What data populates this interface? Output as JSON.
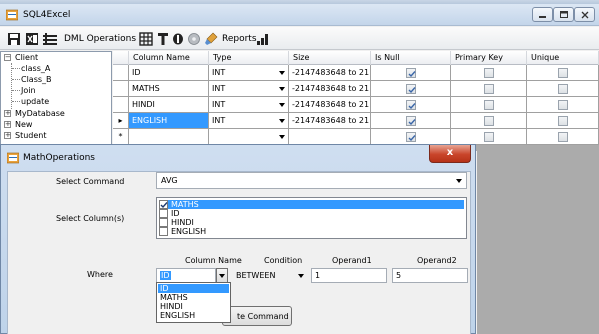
{
  "window": {
    "title": "SQL4Excel"
  },
  "toolbar": {
    "dml_label": "DML Operations",
    "reports_label": "Reports"
  },
  "tree": {
    "items": [
      {
        "label": "Client",
        "expander": "−"
      },
      {
        "label": "class_A"
      },
      {
        "label": "Class_B"
      },
      {
        "label": "Join"
      },
      {
        "label": "update"
      },
      {
        "label": "MyDatabase",
        "expander": "+"
      },
      {
        "label": "New",
        "expander": "+"
      },
      {
        "label": "Student",
        "expander": "+"
      }
    ]
  },
  "grid": {
    "columns": [
      "Column Name",
      "Type",
      "Size",
      "Is Null",
      "Primary Key",
      "Unique"
    ],
    "rows": [
      {
        "name": "ID",
        "type": "INT",
        "size": "-2147483648 to 21...",
        "is_null": true,
        "primary_key": false,
        "unique": false,
        "marker": ""
      },
      {
        "name": "MATHS",
        "type": "INT",
        "size": "-2147483648 to 21...",
        "is_null": true,
        "primary_key": false,
        "unique": false,
        "marker": ""
      },
      {
        "name": "HINDI",
        "type": "INT",
        "size": "-2147483648 to 21...",
        "is_null": true,
        "primary_key": false,
        "unique": false,
        "marker": ""
      },
      {
        "name": "ENGLISH",
        "type": "INT",
        "size": "-2147483648 to 21...",
        "is_null": true,
        "primary_key": false,
        "unique": false,
        "marker": "▸"
      },
      {
        "name": "",
        "type": "",
        "size": "",
        "is_null": true,
        "primary_key": false,
        "unique": false,
        "marker": "*"
      }
    ]
  },
  "dialog": {
    "title": "MathOperations",
    "close_label": "x",
    "select_command_label": "Select Command",
    "command_value": "AVG",
    "select_columns_label": "Select Column(s)",
    "columns": [
      {
        "label": "MATHS",
        "checked": true,
        "selected": true
      },
      {
        "label": "ID",
        "checked": false,
        "selected": false
      },
      {
        "label": "HINDI",
        "checked": false,
        "selected": false
      },
      {
        "label": "ENGLISH",
        "checked": false,
        "selected": false
      }
    ],
    "where_label": "Where",
    "where_headers": {
      "column_name": "Column Name",
      "condition": "Condition",
      "operand1": "Operand1",
      "operand2": "Operand2"
    },
    "where_values": {
      "column_name": "ID",
      "condition": "BETWEEN",
      "operand1": "1",
      "operand2": "5"
    },
    "column_dropdown": [
      "ID",
      "MATHS",
      "HINDI",
      "ENGLISH"
    ],
    "execute_label": "Execute Command",
    "execute_visible": "te Command"
  },
  "colors": {
    "selection": "#3399ff",
    "close_button": "#c9452b",
    "grid_background": "#ababab"
  }
}
